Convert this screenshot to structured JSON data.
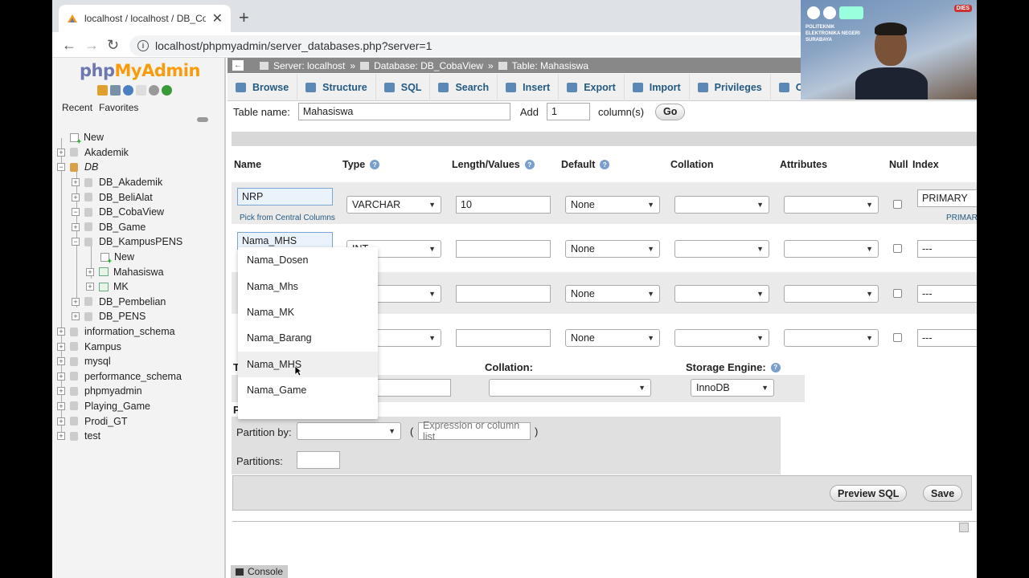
{
  "browser": {
    "tab_title": "localhost / localhost / DB_Coba",
    "url": "localhost/phpmyadmin/server_databases.php?server=1"
  },
  "sidebar": {
    "logo_php": "php",
    "logo_my": "MyAdmin",
    "tabs": [
      "Recent",
      "Favorites"
    ],
    "tree": [
      {
        "label": "New",
        "level": 0,
        "kind": "new"
      },
      {
        "label": "Akademik",
        "level": 0,
        "kind": "db"
      },
      {
        "label": "DB",
        "level": 0,
        "kind": "dbgroup"
      },
      {
        "label": "DB_Akademik",
        "level": 1,
        "kind": "db"
      },
      {
        "label": "DB_BeliAlat",
        "level": 1,
        "kind": "db"
      },
      {
        "label": "DB_CobaView",
        "level": 1,
        "kind": "db"
      },
      {
        "label": "DB_Game",
        "level": 1,
        "kind": "db"
      },
      {
        "label": "DB_KampusPENS",
        "level": 1,
        "kind": "dbopen"
      },
      {
        "label": "New",
        "level": 2,
        "kind": "new"
      },
      {
        "label": "Mahasiswa",
        "level": 2,
        "kind": "table"
      },
      {
        "label": "MK",
        "level": 2,
        "kind": "table"
      },
      {
        "label": "DB_Pembelian",
        "level": 1,
        "kind": "db"
      },
      {
        "label": "DB_PENS",
        "level": 1,
        "kind": "db"
      },
      {
        "label": "information_schema",
        "level": 0,
        "kind": "db"
      },
      {
        "label": "Kampus",
        "level": 0,
        "kind": "db"
      },
      {
        "label": "mysql",
        "level": 0,
        "kind": "db"
      },
      {
        "label": "performance_schema",
        "level": 0,
        "kind": "db"
      },
      {
        "label": "phpmyadmin",
        "level": 0,
        "kind": "db"
      },
      {
        "label": "Playing_Game",
        "level": 0,
        "kind": "db"
      },
      {
        "label": "Prodi_GT",
        "level": 0,
        "kind": "db"
      },
      {
        "label": "test",
        "level": 0,
        "kind": "db"
      }
    ]
  },
  "breadcrumb": {
    "server": "Server: localhost",
    "database": "Database: DB_CobaView",
    "table": "Table: Mahasiswa",
    "sep": "»"
  },
  "nav_tabs": [
    "Browse",
    "Structure",
    "SQL",
    "Search",
    "Insert",
    "Export",
    "Import",
    "Privileges",
    "Op"
  ],
  "form": {
    "table_name_label": "Table name:",
    "table_name_value": "Mahasiswa",
    "add_label": "Add",
    "add_value": "1",
    "columns_label": "column(s)",
    "go_label": "Go"
  },
  "headers": {
    "name": "Name",
    "type": "Type",
    "length": "Length/Values",
    "default": "Default",
    "collation": "Collation",
    "attributes": "Attributes",
    "null": "Null",
    "index": "Index"
  },
  "rows": [
    {
      "name": "NRP",
      "type": "VARCHAR",
      "length": "10",
      "default": "None",
      "index": "PRIMARY",
      "index_sub": "PRIMAR"
    },
    {
      "name": "Nama_MHS",
      "type": "INT",
      "length": "",
      "default": "None",
      "index": "---"
    },
    {
      "name": "",
      "type": "",
      "length": "",
      "default": "None",
      "index": "---"
    },
    {
      "name": "",
      "type": "",
      "length": "",
      "default": "None",
      "index": "---"
    }
  ],
  "pick_central": "Pick from Central Columns",
  "autocomplete": [
    "Nama_Dosen",
    "Nama_Mhs",
    "Nama_MK",
    "Nama_Barang",
    "Nama_MHS",
    "Nama_Game"
  ],
  "table_opts": {
    "collation_label": "Collation:",
    "storage_label": "Storage Engine:",
    "storage_value": "InnoDB",
    "t_fragment": "T",
    "p_fragment": "P"
  },
  "partition": {
    "partition_by_label": "Partition by:",
    "expression_placeholder": "Expression or column list",
    "open_paren": "(",
    "close_paren": ")",
    "partitions_label": "Partitions:"
  },
  "footer": {
    "preview_sql": "Preview SQL",
    "save": "Save"
  },
  "console_label": "Console",
  "webcam": {
    "institution": "POLITEKNIK ELEKTRONIKA NEGERI SURABAYA",
    "badge": "DIES"
  }
}
